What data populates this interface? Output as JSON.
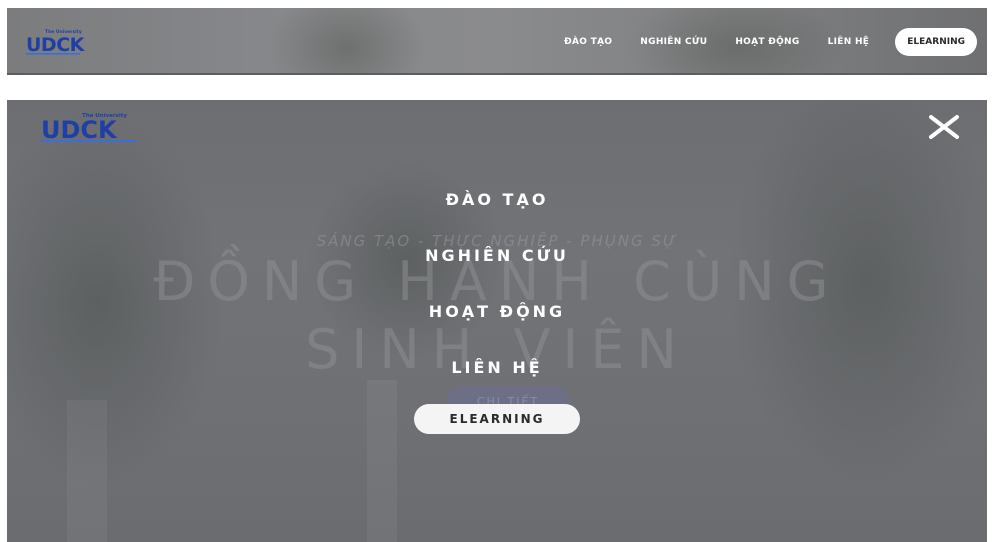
{
  "navbar": {
    "logo": {
      "text": "UDCK",
      "tagline": "The University"
    },
    "links": [
      "ĐÀO TẠO",
      "NGHIÊN CỨU",
      "HOẠT ĐỘNG",
      "LIÊN HỆ"
    ],
    "elearning_label": "ELEARNING"
  },
  "overlay": {
    "logo": {
      "text": "UDCK",
      "tagline": "The University"
    },
    "close_icon": "close-icon",
    "menu": [
      "ĐÀO TẠO",
      "NGHIÊN CỨU",
      "HOẠT ĐỘNG",
      "LIÊN HỆ"
    ],
    "elearning_label": "ELEARNING"
  },
  "background": {
    "tagline": "SÁNG TẠO - THỰC NGHIỆP - PHỤNG SỰ",
    "heading_line1": "ĐỒNG HÀNH CÙNG",
    "heading_line2": "SINH VIÊN",
    "button_label": "CHI TIẾT"
  },
  "colors": {
    "logo_blue": "#1f3fa6",
    "logo_blue_light": "#3b6fd4",
    "overlay_bg": "#6f7175",
    "pill_bg": "#f4f4f4"
  }
}
